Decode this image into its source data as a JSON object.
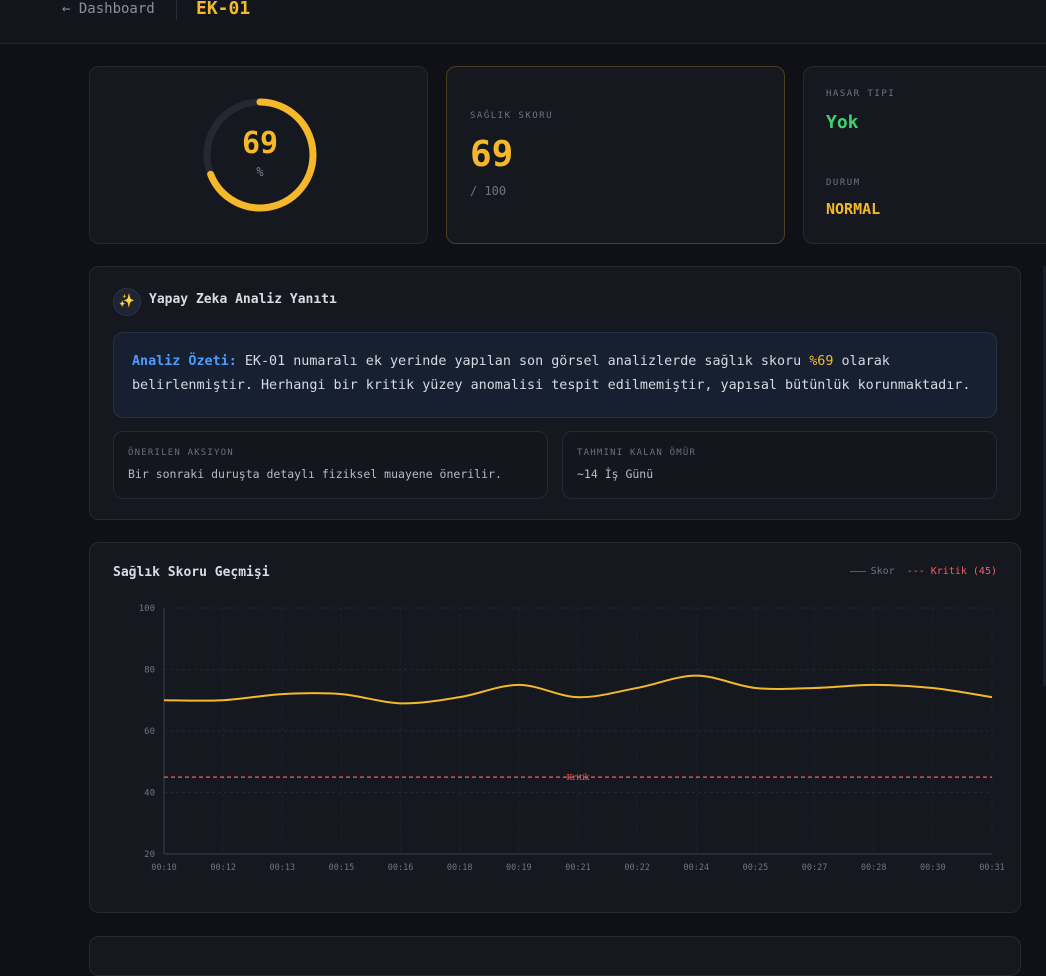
{
  "header": {
    "back_label": "← Dashboard",
    "title": "EK-01"
  },
  "gauge": {
    "value": "69",
    "unit": "%",
    "fraction": 0.69
  },
  "score_card": {
    "label": "SAĞLIK SKORU",
    "value": "69",
    "max": "/ 100"
  },
  "status_card": {
    "damage_label": "HASAR TIPI",
    "damage_value": "Yok",
    "state_label": "DURUM",
    "state_value": "NORMAL"
  },
  "ai": {
    "icon": "sparkles-icon",
    "title": "Yapay Zeka Analiz Yanıtı",
    "summary_label": "Analiz Özeti:",
    "summary_pre": " EK-01 numaralı ek yerinde yapılan son görsel analizlerde sağlık skoru ",
    "summary_highlight": "%69",
    "summary_post": " olarak belirlenmiştir. Herhangi bir kritik yüzey anomalisi tespit edilmemiştir, yapısal bütünlük korunmaktadır.",
    "action_label": "ÖNERILEN AKSIYON",
    "action_value": "Bir sonraki duruşta detaylı fiziksel muayene önerilir.",
    "life_label": "TAHMINI KALAN ÖMÜR",
    "life_value": "~14 İş Günü"
  },
  "chart_data": {
    "type": "line",
    "title": "Sağlık Skoru Geçmişi",
    "x": [
      "00:10",
      "00:12",
      "00:13",
      "00:15",
      "00:16",
      "00:18",
      "00:19",
      "00:21",
      "00:22",
      "00:24",
      "00:25",
      "00:27",
      "00:28",
      "00:30",
      "00:31"
    ],
    "series": [
      {
        "name": "Skor",
        "values": [
          70,
          70,
          72,
          72,
          69,
          71,
          75,
          71,
          74,
          78,
          74,
          74,
          75,
          74,
          71
        ]
      }
    ],
    "threshold": {
      "name": "Kritik (45)",
      "value": 45,
      "label": "Kritik"
    },
    "legend": [
      "Skor",
      "--- Kritik (45)"
    ],
    "ylim": [
      20,
      100
    ],
    "yticks": [
      20,
      40,
      60,
      80,
      100
    ],
    "grid": true,
    "legend_position": "top-right",
    "colors": {
      "series": "#f5b82a",
      "threshold": "#ff5a5a"
    }
  }
}
